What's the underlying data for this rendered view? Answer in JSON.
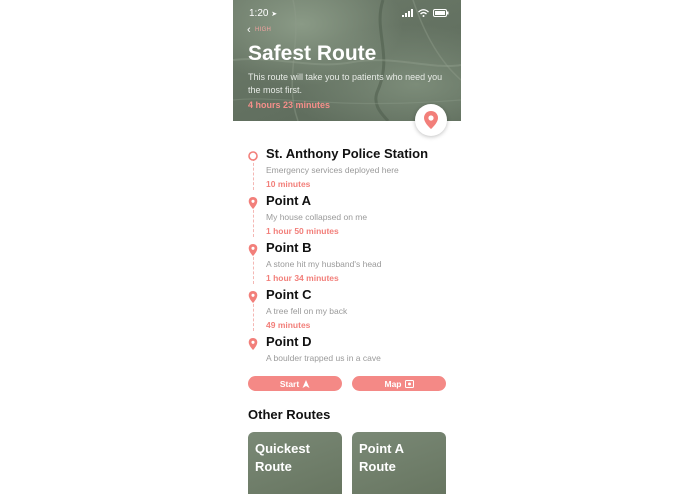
{
  "status": {
    "time": "1:20"
  },
  "header": {
    "back_label": "HIGH",
    "title": "Safest Route",
    "subtitle": "This route will take you to patients who need you the most first.",
    "duration": "4 hours 23 minutes"
  },
  "stops": [
    {
      "name": "St. Anthony Police Station",
      "desc": "Emergency services deployed here",
      "time": "10 minutes"
    },
    {
      "name": "Point A",
      "desc": "My house collapsed on me",
      "time": "1 hour 50 minutes"
    },
    {
      "name": "Point B",
      "desc": "A stone hit my husband's head",
      "time": "1 hour 34 minutes"
    },
    {
      "name": "Point C",
      "desc": "A tree fell on my back",
      "time": "49 minutes"
    },
    {
      "name": "Point D",
      "desc": "A boulder trapped us in a cave",
      "time": ""
    }
  ],
  "buttons": {
    "start": "Start",
    "map": "Map"
  },
  "other_routes": {
    "title": "Other Routes",
    "cards": [
      {
        "label": "Quickest Route"
      },
      {
        "label": "Point A Route"
      }
    ]
  },
  "colors": {
    "accent": "#f48986",
    "accent_text": "#f27f7a"
  }
}
